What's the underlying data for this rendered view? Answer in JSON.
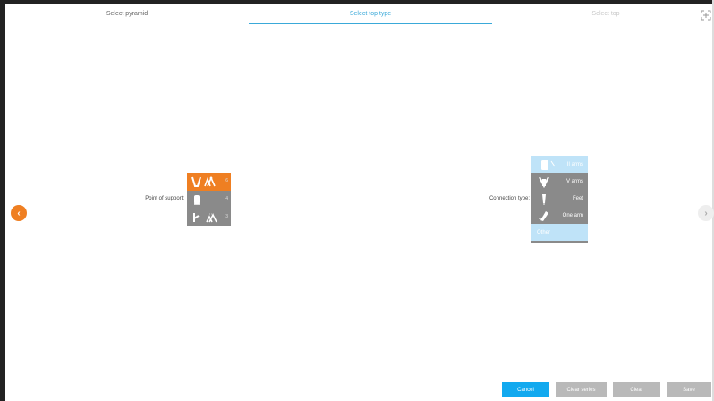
{
  "steps": {
    "tab1": "Select pyramid",
    "tab2": "Select top type",
    "tab3": "Select top"
  },
  "icons": {
    "expand": "expand-arrows-icon",
    "prev": "chevron-left-icon",
    "next": "chevron-right-icon"
  },
  "nav": {
    "prev": "‹",
    "next": "›"
  },
  "support": {
    "label": "Point of support:",
    "options": [
      {
        "idx": "6",
        "selected": true
      },
      {
        "idx": "4",
        "selected": false
      },
      {
        "idx": "3",
        "selected": false
      }
    ]
  },
  "connection": {
    "label": "Connection type:",
    "options": [
      {
        "label": "II arms",
        "selected": true
      },
      {
        "label": "V arms",
        "selected": false
      },
      {
        "label": "Feet",
        "selected": false
      },
      {
        "label": "One arm",
        "selected": false
      },
      {
        "label": "Other",
        "selected": false
      }
    ]
  },
  "actions": {
    "cancel": "Cancel",
    "clear_series": "Clear series",
    "clear": "Clear",
    "save": "Save"
  },
  "colors": {
    "accent": "#ef7f22",
    "primary": "#12a9ef",
    "selected_light": "#bfe3f8",
    "panel_gray": "#8a8a8a",
    "disabled_button": "#b9b9b9"
  }
}
